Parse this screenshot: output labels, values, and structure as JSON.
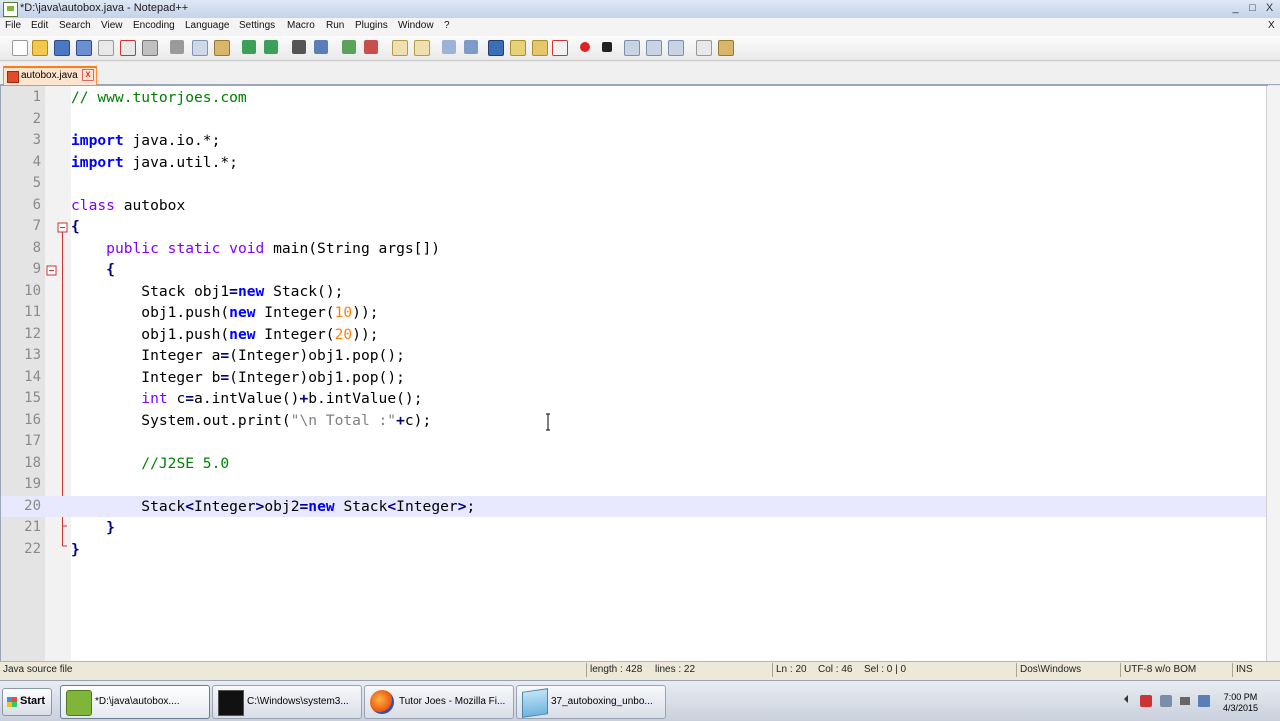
{
  "window": {
    "title": "*D:\\java\\autobox.java - Notepad++",
    "minimize": "_",
    "maximize": "□",
    "close": "X",
    "doc_close": "X"
  },
  "menu": [
    "File",
    "Edit",
    "Search",
    "View",
    "Encoding",
    "Language",
    "Settings",
    "Macro",
    "Run",
    "Plugins",
    "Window",
    "?"
  ],
  "tab": {
    "label": "autobox.java",
    "close": "x"
  },
  "editor": {
    "current_line": 20,
    "lines": [
      {
        "n": "1",
        "tokens": [
          {
            "c": "cm",
            "t": "// www.tutorjoes.com"
          }
        ]
      },
      {
        "n": "2",
        "tokens": []
      },
      {
        "n": "3",
        "tokens": [
          {
            "c": "kw",
            "t": "import"
          },
          {
            "c": "",
            "t": " java.io.*;"
          }
        ]
      },
      {
        "n": "4",
        "tokens": [
          {
            "c": "kw",
            "t": "import"
          },
          {
            "c": "",
            "t": " java.util.*;"
          }
        ]
      },
      {
        "n": "5",
        "tokens": []
      },
      {
        "n": "6",
        "tokens": [
          {
            "c": "ty",
            "t": "class"
          },
          {
            "c": "",
            "t": " autobox"
          }
        ]
      },
      {
        "n": "7",
        "tokens": [
          {
            "c": "op",
            "t": "{"
          }
        ]
      },
      {
        "n": "8",
        "tokens": [
          {
            "c": "",
            "t": "    "
          },
          {
            "c": "ty",
            "t": "public static void"
          },
          {
            "c": "",
            "t": " main(String args[])"
          }
        ]
      },
      {
        "n": "9",
        "tokens": [
          {
            "c": "",
            "t": "    "
          },
          {
            "c": "op",
            "t": "{"
          }
        ]
      },
      {
        "n": "10",
        "tokens": [
          {
            "c": "",
            "t": "        Stack obj1"
          },
          {
            "c": "op",
            "t": "="
          },
          {
            "c": "kw",
            "t": "new"
          },
          {
            "c": "",
            "t": " Stack();"
          }
        ]
      },
      {
        "n": "11",
        "tokens": [
          {
            "c": "",
            "t": "        obj1.push("
          },
          {
            "c": "kw",
            "t": "new"
          },
          {
            "c": "",
            "t": " Integer("
          },
          {
            "c": "nm",
            "t": "10"
          },
          {
            "c": "",
            "t": "));"
          }
        ]
      },
      {
        "n": "12",
        "tokens": [
          {
            "c": "",
            "t": "        obj1.push("
          },
          {
            "c": "kw",
            "t": "new"
          },
          {
            "c": "",
            "t": " Integer("
          },
          {
            "c": "nm",
            "t": "20"
          },
          {
            "c": "",
            "t": "));"
          }
        ]
      },
      {
        "n": "13",
        "tokens": [
          {
            "c": "",
            "t": "        Integer a"
          },
          {
            "c": "op",
            "t": "="
          },
          {
            "c": "",
            "t": "(Integer)obj1.pop();"
          }
        ]
      },
      {
        "n": "14",
        "tokens": [
          {
            "c": "",
            "t": "        Integer b"
          },
          {
            "c": "op",
            "t": "="
          },
          {
            "c": "",
            "t": "(Integer)obj1.pop();"
          }
        ]
      },
      {
        "n": "15",
        "tokens": [
          {
            "c": "",
            "t": "        "
          },
          {
            "c": "ty",
            "t": "int"
          },
          {
            "c": "",
            "t": " c"
          },
          {
            "c": "op",
            "t": "="
          },
          {
            "c": "",
            "t": "a.intValue()"
          },
          {
            "c": "op",
            "t": "+"
          },
          {
            "c": "",
            "t": "b.intValue();"
          }
        ]
      },
      {
        "n": "16",
        "tokens": [
          {
            "c": "",
            "t": "        System.out.print("
          },
          {
            "c": "st",
            "t": "\"\\n Total :\""
          },
          {
            "c": "op",
            "t": "+"
          },
          {
            "c": "",
            "t": "c);"
          }
        ]
      },
      {
        "n": "17",
        "tokens": []
      },
      {
        "n": "18",
        "tokens": [
          {
            "c": "",
            "t": "        "
          },
          {
            "c": "cm",
            "t": "//J2SE 5.0"
          }
        ]
      },
      {
        "n": "19",
        "tokens": []
      },
      {
        "n": "20",
        "tokens": [
          {
            "c": "",
            "t": "        Stack"
          },
          {
            "c": "op",
            "t": "<"
          },
          {
            "c": "",
            "t": "Integer"
          },
          {
            "c": "op",
            "t": ">"
          },
          {
            "c": "",
            "t": "obj2"
          },
          {
            "c": "op",
            "t": "="
          },
          {
            "c": "kw",
            "t": "new"
          },
          {
            "c": "",
            "t": " Stack"
          },
          {
            "c": "op",
            "t": "<"
          },
          {
            "c": "",
            "t": "Integer"
          },
          {
            "c": "op",
            "t": ">"
          },
          {
            "c": "",
            "t": ";"
          }
        ]
      },
      {
        "n": "21",
        "tokens": [
          {
            "c": "",
            "t": "    "
          },
          {
            "c": "op",
            "t": "}"
          }
        ]
      },
      {
        "n": "22",
        "tokens": [
          {
            "c": "op",
            "t": "}"
          }
        ]
      }
    ]
  },
  "status": {
    "file_type": "Java source file",
    "length": "length : 428",
    "lines": "lines : 22",
    "ln": "Ln : 20",
    "col": "Col : 46",
    "sel": "Sel : 0 | 0",
    "eol": "Dos\\Windows",
    "encoding": "UTF-8 w/o BOM",
    "mode": "INS"
  },
  "taskbar": {
    "start": "Start",
    "tasks": [
      {
        "label": "*D:\\java\\autobox....",
        "icon": "notepadpp-icon",
        "active": true
      },
      {
        "label": "C:\\Windows\\system3...",
        "icon": "cmd-icon",
        "active": false
      },
      {
        "label": "Tutor Joes - Mozilla Fi...",
        "icon": "firefox-icon",
        "active": false
      },
      {
        "label": "37_autoboxing_unbo...",
        "icon": "video-file-icon",
        "active": false
      }
    ],
    "clock_time": "7:00 PM",
    "clock_date": "4/3/2015"
  },
  "colors": {
    "keyword": "#0000ff",
    "type": "#8000ff",
    "comment": "#008000",
    "string": "#808080",
    "number": "#ff8000",
    "current_line": "#e8e8ff",
    "tab_accent": "#ff7a1a"
  }
}
